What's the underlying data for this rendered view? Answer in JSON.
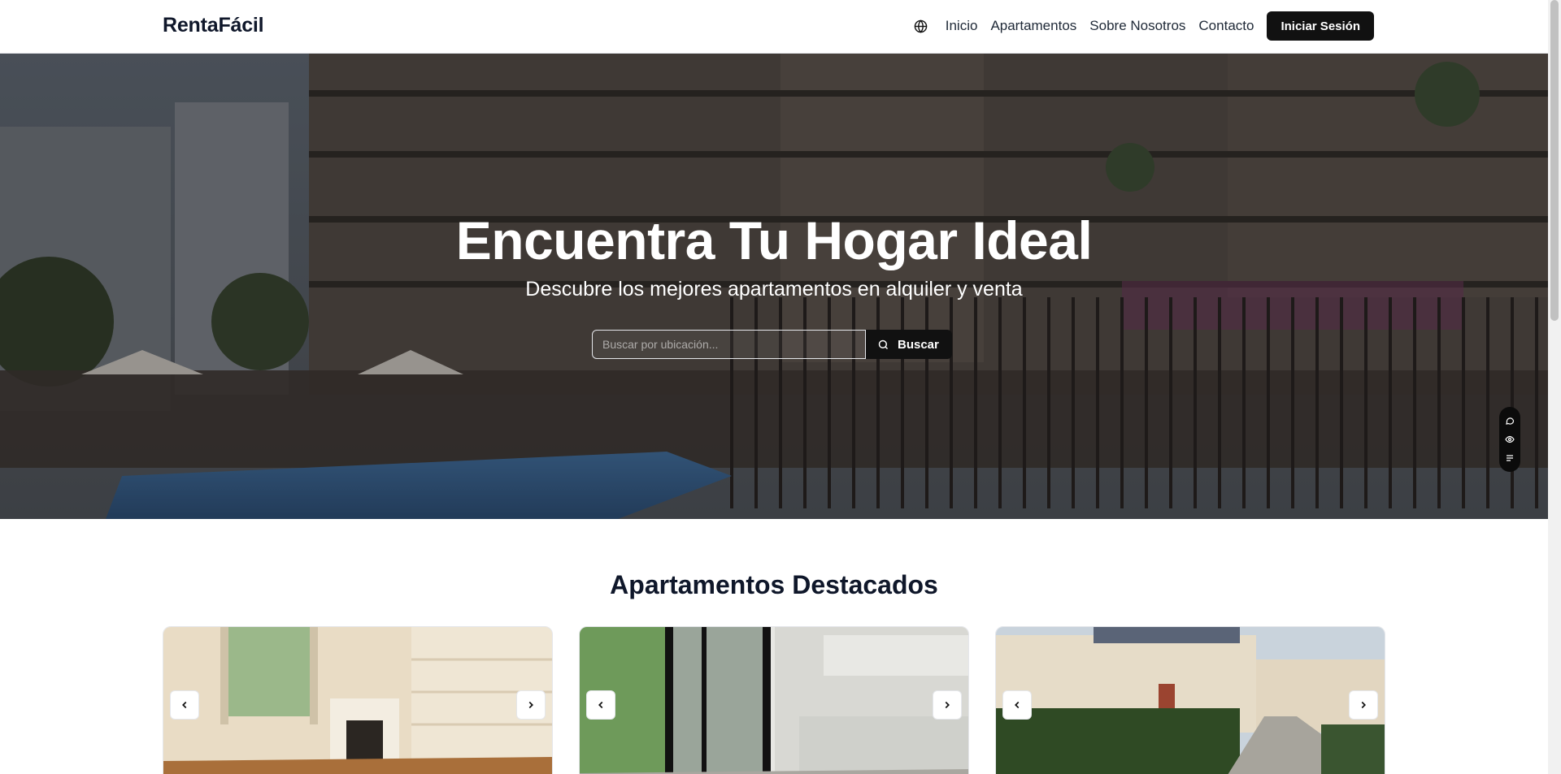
{
  "brand": "RentaFácil",
  "nav": {
    "language_icon": "globe-icon",
    "links": [
      "Inicio",
      "Apartamentos",
      "Sobre Nosotros",
      "Contacto"
    ],
    "login_label": "Iniciar Sesión"
  },
  "hero": {
    "title": "Encuentra Tu Hogar Ideal",
    "subtitle": "Descubre los mejores apartamentos en alquiler y venta",
    "search_placeholder": "Buscar por ubicación...",
    "search_button": "Buscar",
    "search_icon": "search-icon"
  },
  "side_tools": [
    "chat-icon",
    "eye-icon",
    "list-icon"
  ],
  "featured": {
    "title": "Apartamentos Destacados",
    "cards": [
      {
        "image": "living-room-with-fireplace",
        "prev_icon": "chevron-left-icon",
        "next_icon": "chevron-right-icon"
      },
      {
        "image": "kitchen-with-glass-door",
        "prev_icon": "chevron-left-icon",
        "next_icon": "chevron-right-icon"
      },
      {
        "image": "building-exterior-with-garden",
        "prev_icon": "chevron-left-icon",
        "next_icon": "chevron-right-icon"
      }
    ]
  },
  "colors": {
    "accent": "#111111",
    "text": "#0f172a",
    "border": "#e5e7eb"
  }
}
